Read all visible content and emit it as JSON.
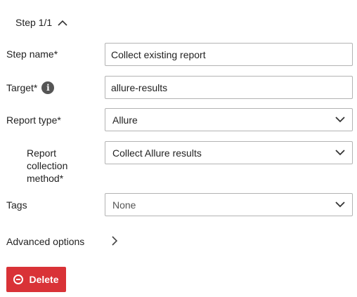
{
  "step": {
    "title": "Step 1/1"
  },
  "fields": {
    "step_name": {
      "label": "Step name*",
      "value": "Collect existing report"
    },
    "target": {
      "label": "Target*",
      "info_icon": "info-icon",
      "value": "allure-results"
    },
    "report_type": {
      "label": "Report type*",
      "value": "Allure"
    },
    "report_collection_method": {
      "label_line1": "Report",
      "label_line2": "collection",
      "label_line3": "method*",
      "value": "Collect Allure results"
    },
    "tags": {
      "label": "Tags",
      "value": "None"
    }
  },
  "advanced": {
    "label": "Advanced options"
  },
  "actions": {
    "delete_label": "Delete"
  },
  "colors": {
    "danger": "#d93237",
    "border": "#b3b3b3",
    "info_bg": "#555555"
  },
  "icons": {
    "collapse": "chevron-up-icon",
    "dropdown": "chevron-down-icon",
    "expand": "chevron-right-icon",
    "delete": "minus-circle-icon"
  }
}
